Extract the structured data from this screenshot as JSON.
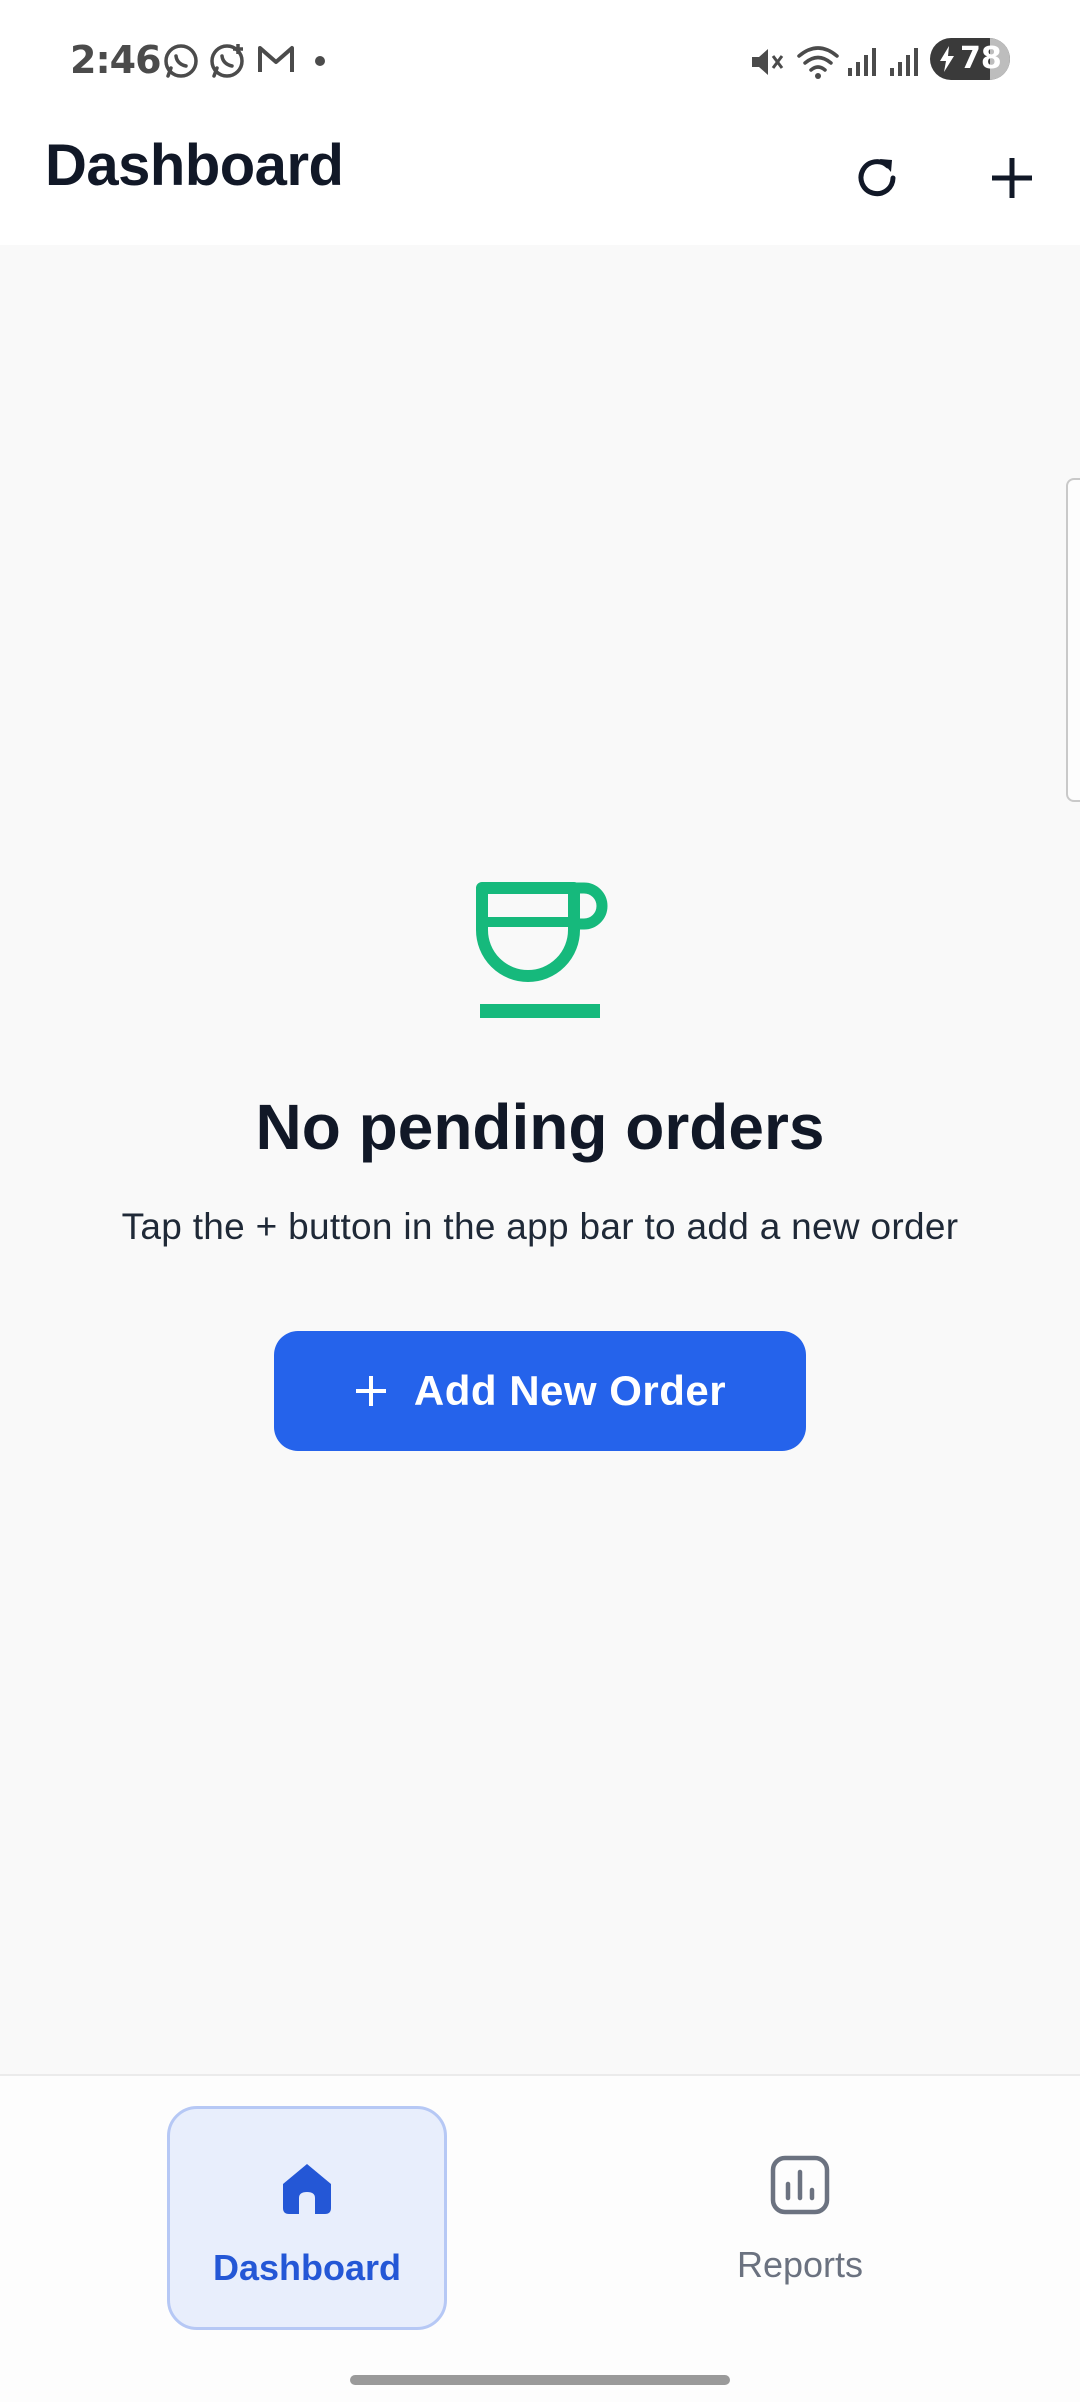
{
  "status_bar": {
    "time": "2:46",
    "battery_level": "78",
    "notification_icons": [
      "whatsapp-icon",
      "whatsapp-business-icon",
      "gmail-icon",
      "dot-icon"
    ],
    "system_icons": [
      "mute-icon",
      "wifi-icon",
      "signal-icon",
      "signal-icon"
    ]
  },
  "app_bar": {
    "title": "Dashboard",
    "actions": [
      "refresh-icon",
      "add-icon"
    ]
  },
  "empty_state": {
    "icon": "cup-icon",
    "icon_color": "#16b97c",
    "title": "No pending orders",
    "subtitle": "Tap the + button in the app bar to add a new order",
    "button_label": "Add New Order",
    "button_color": "#2563eb"
  },
  "bottom_nav": {
    "items": [
      {
        "label": "Dashboard",
        "icon": "home-icon",
        "active": true
      },
      {
        "label": "Reports",
        "icon": "bar-chart-icon",
        "active": false
      }
    ],
    "active_color": "#2457d6"
  }
}
